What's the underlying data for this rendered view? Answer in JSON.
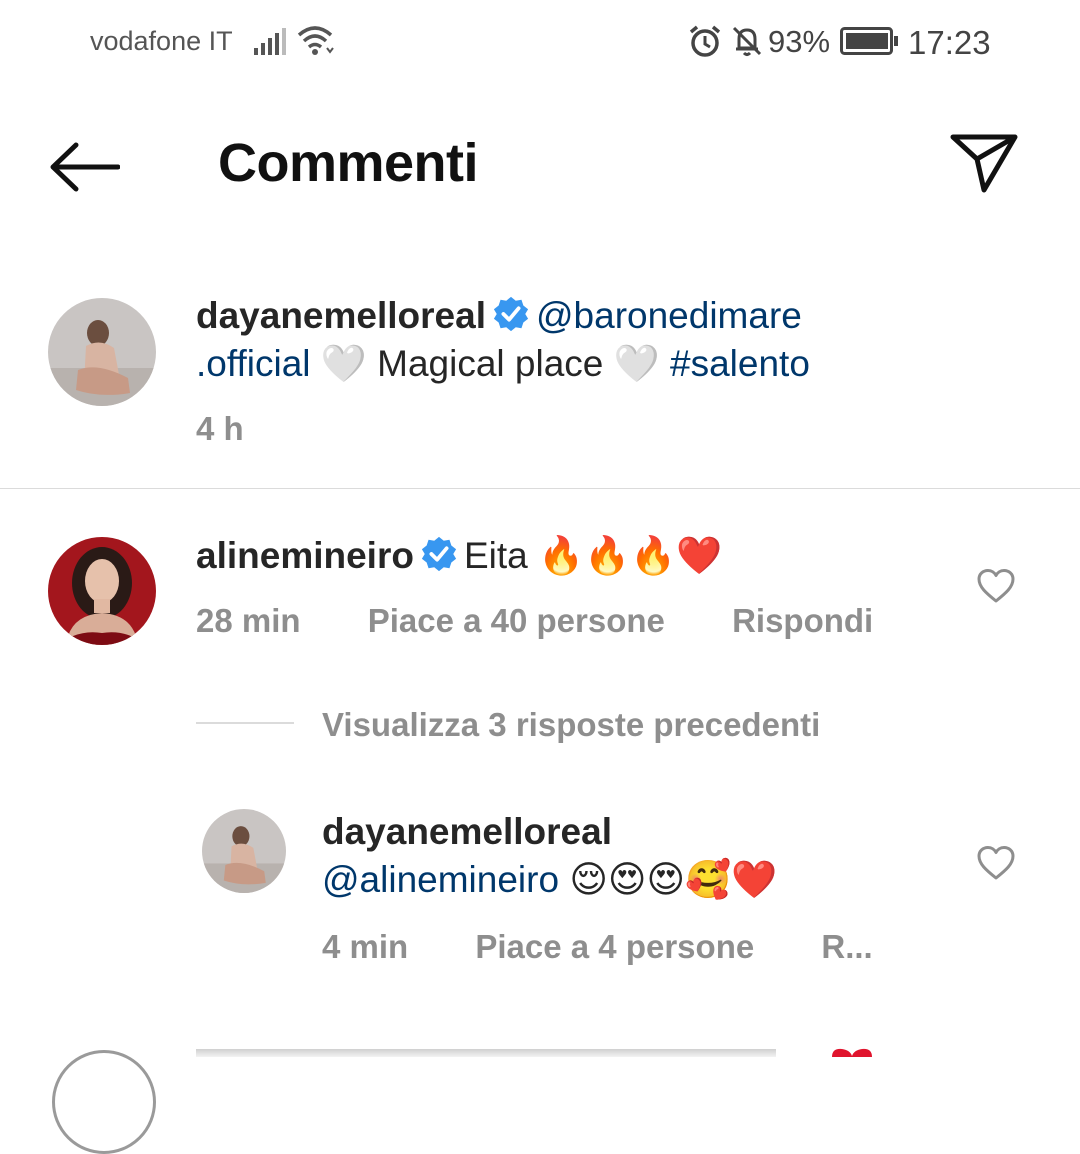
{
  "status_bar": {
    "carrier": "vodafone IT",
    "battery_percent": "93%",
    "time": "17:23",
    "icons": [
      "signal-icon",
      "wifi-icon",
      "alarm-icon",
      "mute-icon",
      "battery-icon"
    ]
  },
  "header": {
    "title": "Commenti",
    "back_icon": "arrow-left-icon",
    "share_icon": "paper-plane-icon"
  },
  "caption": {
    "username": "dayanemelloreal",
    "mention_part1": "@baronedimare",
    "mention_part2": ".official",
    "text_mid": "Magical place",
    "hashtag": "#salento",
    "heart_emoji": "🤍",
    "time": "4 h"
  },
  "comment": {
    "username": "alinemineiro",
    "text": "Eita",
    "emojis": "🔥🔥🔥❤️",
    "time": "28 min",
    "likes": "Piace a 40 persone",
    "reply": "Rispondi"
  },
  "view_replies": "Visualizza 3 risposte precedenti",
  "reply": {
    "username": "dayanemelloreal",
    "mention": "@alinemineiro",
    "emojis": "😌😍😍🥰❤️",
    "time": "4 min",
    "likes": "Piace a 4 persone",
    "reply_truncated": "R..."
  },
  "colors": {
    "verified": "#3897f0",
    "link": "#00376b",
    "meta": "#8e8e8e",
    "divider": "#dbdbdb"
  }
}
